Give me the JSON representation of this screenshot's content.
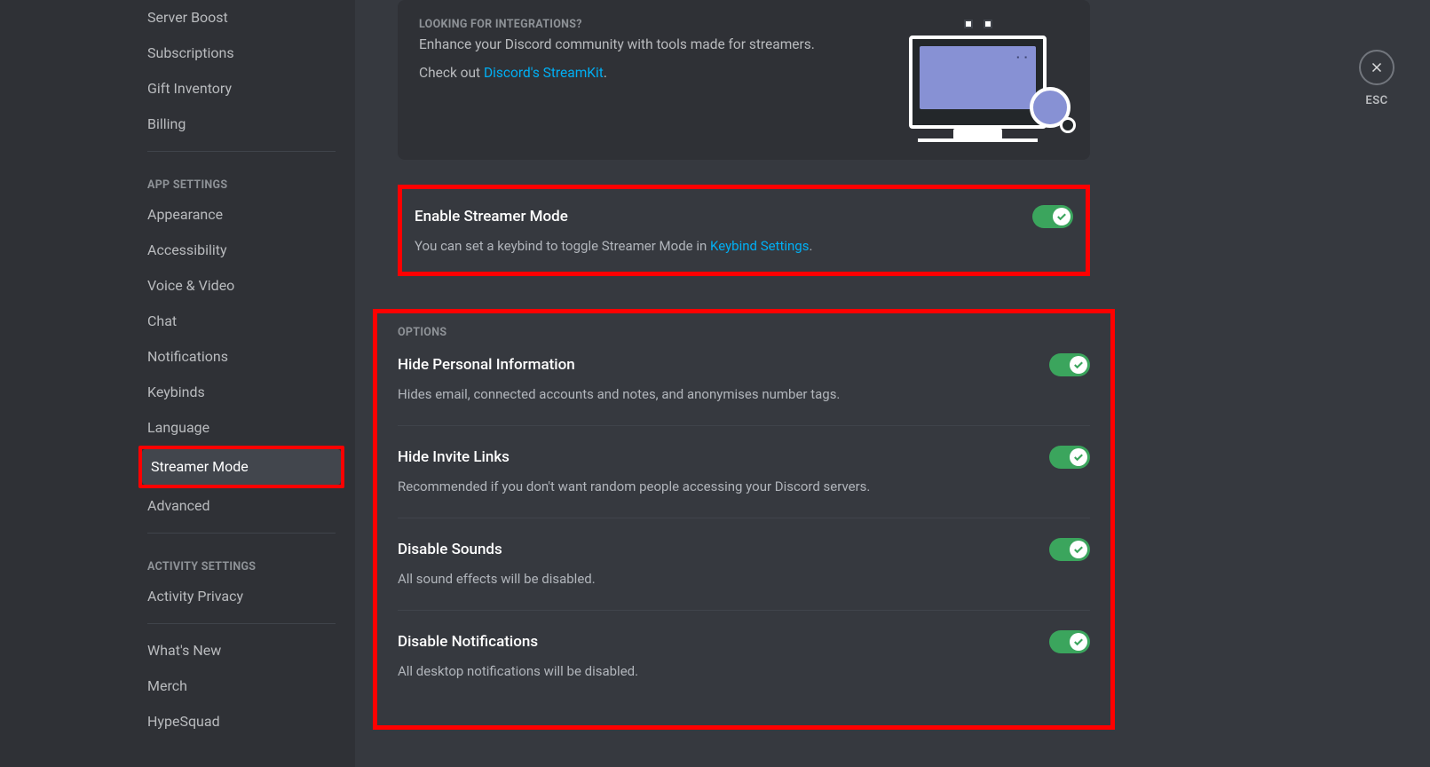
{
  "sidebar": {
    "items_top": [
      "Server Boost",
      "Subscriptions",
      "Gift Inventory",
      "Billing"
    ],
    "header_app": "APP SETTINGS",
    "items_app": [
      "Appearance",
      "Accessibility",
      "Voice & Video",
      "Chat",
      "Notifications",
      "Keybinds",
      "Language",
      "Streamer Mode",
      "Advanced"
    ],
    "active_app_item": "Streamer Mode",
    "header_activity": "ACTIVITY SETTINGS",
    "items_activity": [
      "Activity Privacy"
    ],
    "items_bottom": [
      "What's New",
      "Merch",
      "HypeSquad"
    ]
  },
  "integration": {
    "title": "LOOKING FOR INTEGRATIONS?",
    "desc": "Enhance your Discord community with tools made for streamers.",
    "check_prefix": "Check out ",
    "link": "Discord's StreamKit",
    "period": "."
  },
  "enable": {
    "title": "Enable Streamer Mode",
    "desc_prefix": "You can set a keybind to toggle Streamer Mode in ",
    "link": "Keybind Settings",
    "period": "."
  },
  "options": {
    "header": "OPTIONS",
    "items": [
      {
        "title": "Hide Personal Information",
        "desc": "Hides email, connected accounts and notes, and anonymises number tags.",
        "on": true
      },
      {
        "title": "Hide Invite Links",
        "desc": "Recommended if you don't want random people accessing your Discord servers.",
        "on": true
      },
      {
        "title": "Disable Sounds",
        "desc": "All sound effects will be disabled.",
        "on": true
      },
      {
        "title": "Disable Notifications",
        "desc": "All desktop notifications will be disabled.",
        "on": true
      }
    ]
  },
  "esc_label": "ESC"
}
